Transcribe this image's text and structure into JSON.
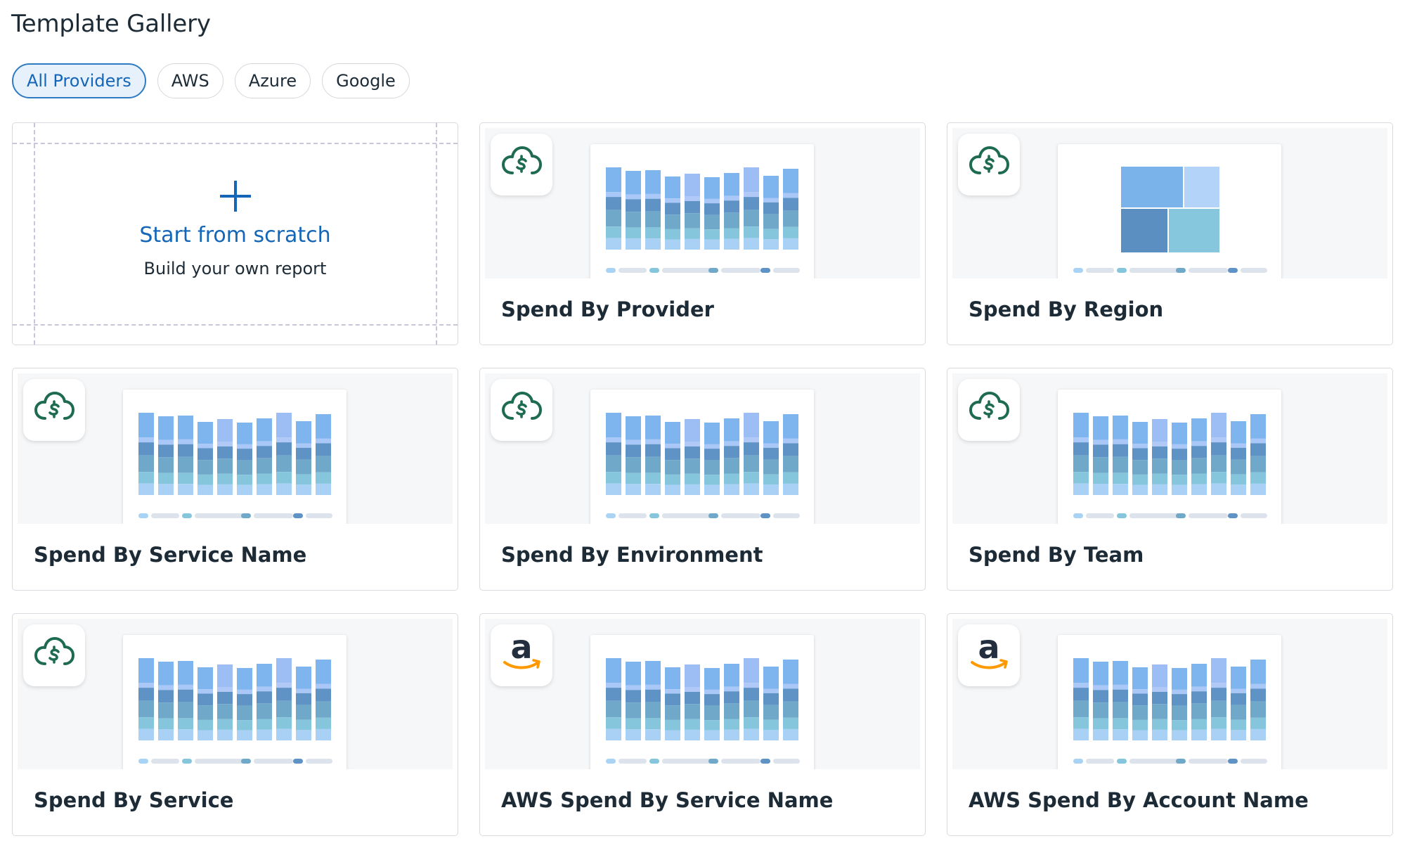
{
  "page": {
    "title": "Template Gallery"
  },
  "filters": [
    {
      "label": "All Providers",
      "active": true
    },
    {
      "label": "AWS",
      "active": false
    },
    {
      "label": "Azure",
      "active": false
    },
    {
      "label": "Google",
      "active": false
    }
  ],
  "scratch": {
    "title": "Start from scratch",
    "subtitle": "Build your own report",
    "icon": "plus-icon"
  },
  "templates": [
    {
      "title": "Spend By Provider",
      "icon": "cloud-dollar-icon",
      "preview": "stacked-bar"
    },
    {
      "title": "Spend By Region",
      "icon": "cloud-dollar-icon",
      "preview": "treemap"
    },
    {
      "title": "Spend By Service Name",
      "icon": "cloud-dollar-icon",
      "preview": "stacked-bar"
    },
    {
      "title": "Spend By Environment",
      "icon": "cloud-dollar-icon",
      "preview": "stacked-bar"
    },
    {
      "title": "Spend By Team",
      "icon": "cloud-dollar-icon",
      "preview": "stacked-bar"
    },
    {
      "title": "Spend By Service",
      "icon": "cloud-dollar-icon",
      "preview": "stacked-bar"
    },
    {
      "title": "AWS Spend By Service Name",
      "icon": "amazon-logo-icon",
      "preview": "stacked-bar"
    },
    {
      "title": "AWS Spend By Account Name",
      "icon": "amazon-logo-icon",
      "preview": "stacked-bar"
    }
  ],
  "colors": {
    "accent": "#1466b8",
    "brand_green": "#1e6b52",
    "amazon_orange": "#ff9900"
  }
}
